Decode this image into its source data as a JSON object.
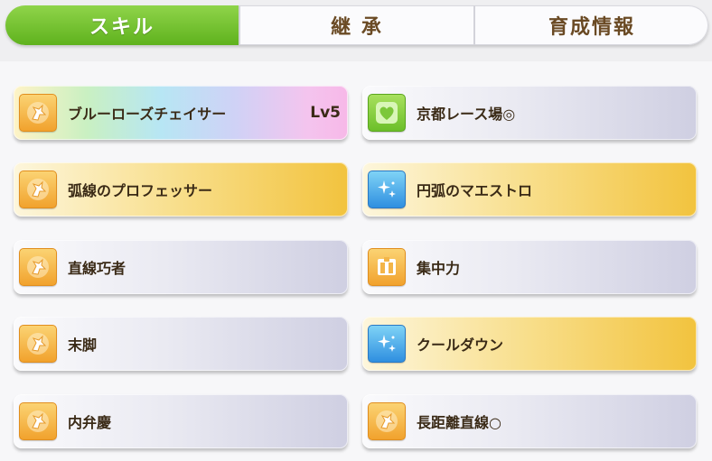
{
  "tabs": [
    {
      "label": "スキル",
      "active": true
    },
    {
      "label": "継 承",
      "active": false
    },
    {
      "label": "育成情報",
      "active": false
    }
  ],
  "skills": [
    {
      "name": "ブルーローズチェイサー",
      "level": "Lv5",
      "icon": "rider-icon",
      "style": "rainbow"
    },
    {
      "name": "京都レース場◎",
      "icon": "heart-icon",
      "style": "normal"
    },
    {
      "name": "弧線のプロフェッサー",
      "icon": "rider-icon",
      "style": "gold"
    },
    {
      "name": "円弧のマエストロ",
      "icon": "sparkle-icon",
      "style": "gold"
    },
    {
      "name": "直線巧者",
      "icon": "rider-icon",
      "style": "normal"
    },
    {
      "name": "集中力",
      "icon": "gate-icon",
      "style": "normal"
    },
    {
      "name": "末脚",
      "icon": "rider-icon",
      "style": "normal"
    },
    {
      "name": "クールダウン",
      "icon": "sparkle-icon",
      "style": "gold"
    },
    {
      "name": "内弁慶",
      "icon": "rider-icon",
      "style": "normal"
    },
    {
      "name": "長距離直線○",
      "icon": "rider-icon",
      "style": "normal"
    }
  ],
  "colors": {
    "active_tab": "#6cc02a",
    "text": "#3a2a16",
    "gold": "#f2c33e"
  }
}
